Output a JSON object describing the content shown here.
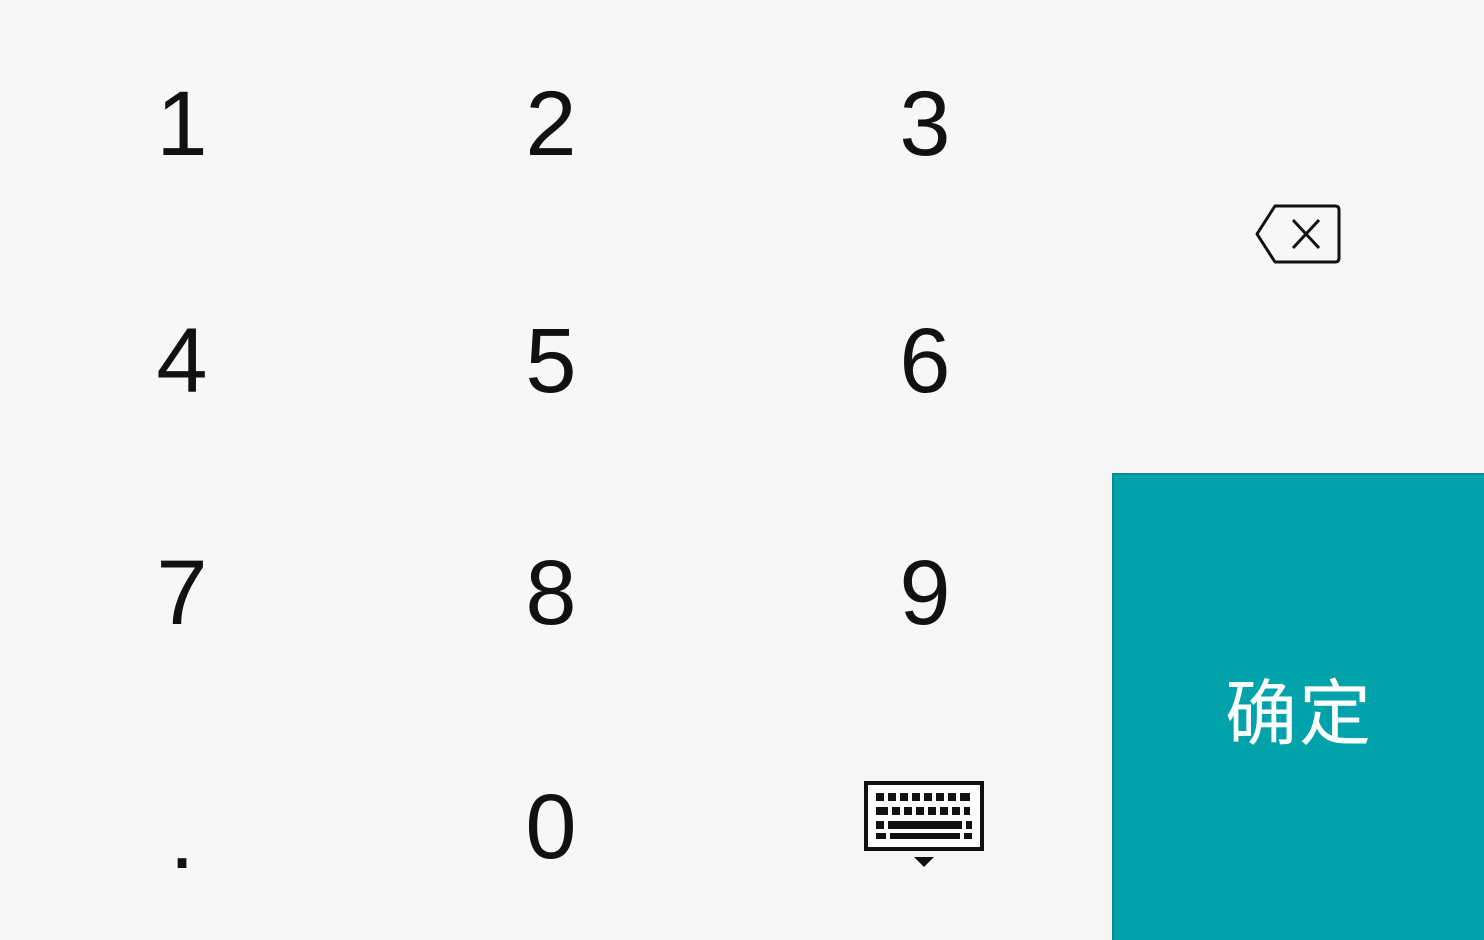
{
  "keypad": {
    "keys": {
      "one": "1",
      "two": "2",
      "three": "3",
      "four": "4",
      "five": "5",
      "six": "6",
      "seven": "7",
      "eight": "8",
      "nine": "9",
      "dot": ".",
      "zero": "0"
    },
    "backspace_icon": "backspace-icon",
    "hide_keyboard_icon": "keyboard-hide-icon",
    "confirm_label": "确定",
    "accent_color": "#01a2a9"
  }
}
